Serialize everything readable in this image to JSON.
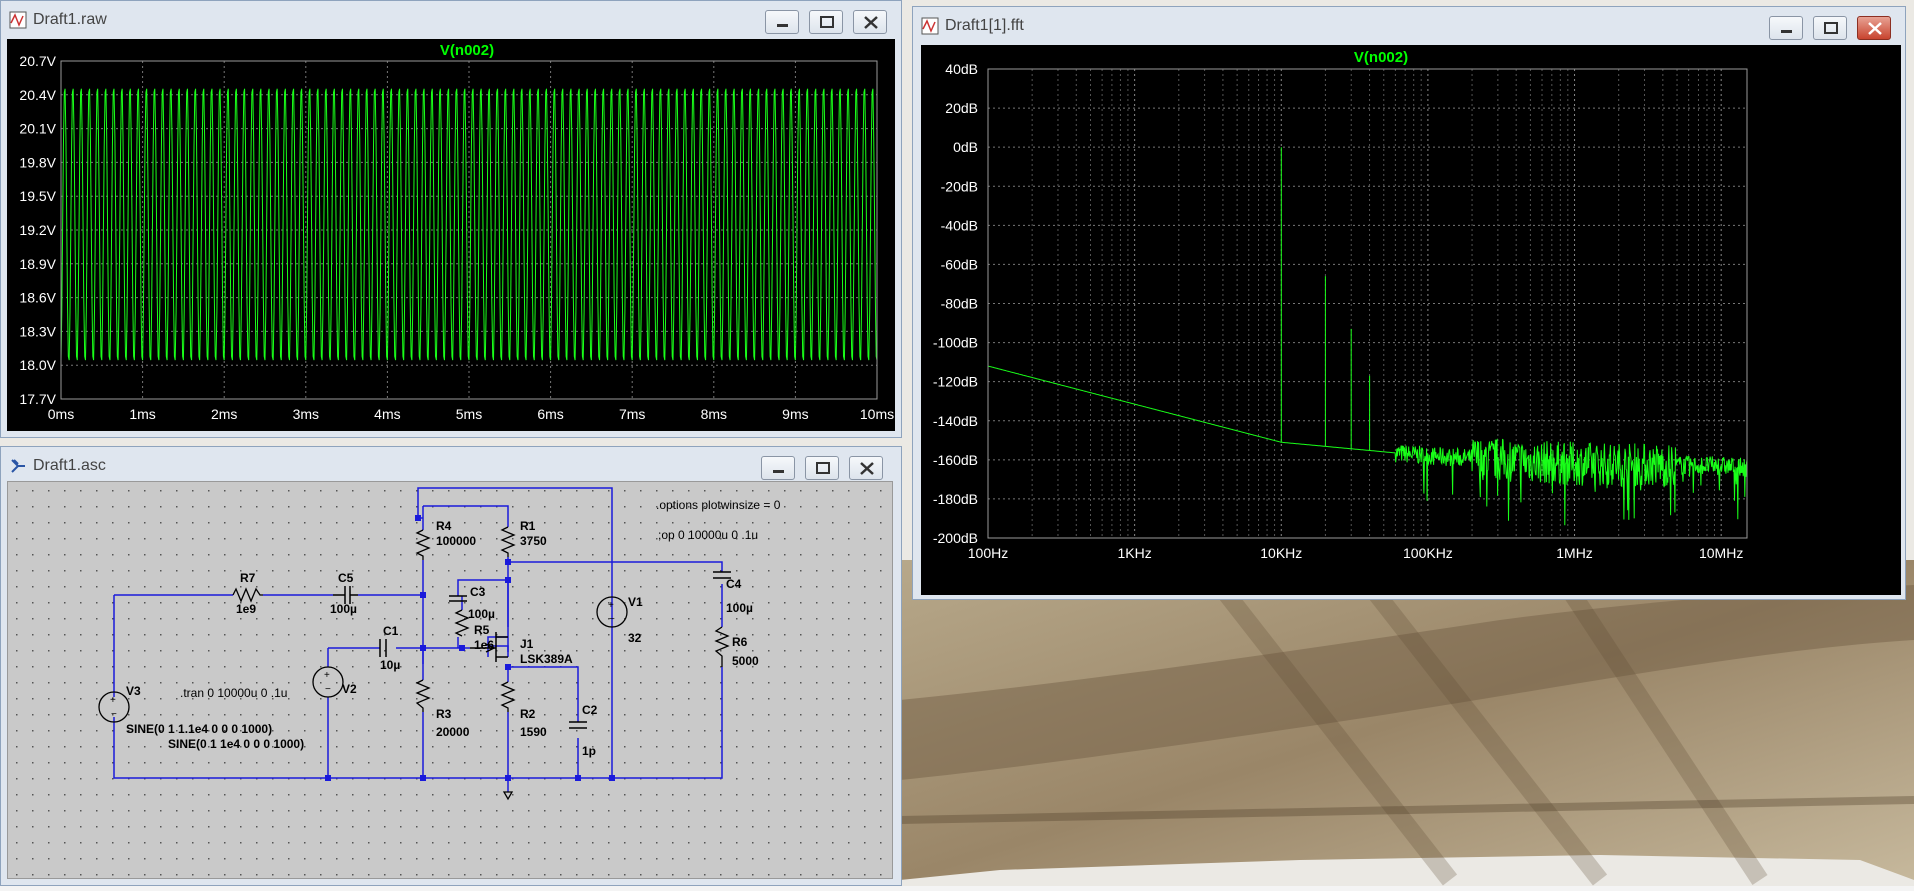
{
  "windows": {
    "raw": {
      "title": "Draft1.raw",
      "trace": "V(n002)",
      "y_ticks": [
        "20.7V",
        "20.4V",
        "20.1V",
        "19.8V",
        "19.5V",
        "19.2V",
        "18.9V",
        "18.6V",
        "18.3V",
        "18.0V",
        "17.7V"
      ],
      "x_ticks": [
        "0ms",
        "1ms",
        "2ms",
        "3ms",
        "4ms",
        "5ms",
        "6ms",
        "7ms",
        "8ms",
        "9ms",
        "10ms"
      ]
    },
    "fft": {
      "title": "Draft1[1].fft",
      "trace": "V(n002)",
      "y_ticks": [
        "40dB",
        "20dB",
        "0dB",
        "-20dB",
        "-40dB",
        "-60dB",
        "-80dB",
        "-100dB",
        "-120dB",
        "-140dB",
        "-160dB",
        "-180dB",
        "-200dB"
      ],
      "x_ticks": [
        "100Hz",
        "1KHz",
        "10KHz",
        "100KHz",
        "1MHz",
        "10MHz"
      ]
    },
    "schematic": {
      "title": "Draft1.asc",
      "labels": {
        "r7": "R7",
        "r7v": "1e9",
        "c5": "C5",
        "c5v": "100µ",
        "r4": "R4",
        "r4v": "100000",
        "r1": "R1",
        "r1v": "3750",
        "c3": "C3",
        "c3v": "100µ",
        "r5": "R5",
        "r5v": "1e6",
        "j1": "J1",
        "j1v": "LSK389A",
        "v1": "V1",
        "v1v": "32",
        "c4": "C4",
        "c4v": "100µ",
        "r6": "R6",
        "r6v": "5000",
        "c1": "C1",
        "c1v": "10µ",
        "v3": "V3",
        "v3v": "SINE(0 1 1.1e4 0 0 0 1000)",
        "v2": "V2",
        "v2v": "SINE(0 1 1e4 0 0 0 1000)",
        "r3": "R3",
        "r3v": "20000",
        "r2": "R2",
        "r2v": "1590",
        "c2": "C2",
        "c2v": "1p"
      },
      "directives": {
        "options": ".options plotwinsize = 0",
        "op": ";op 0 10000u 0 .1u",
        "tran": ".tran 0 10000u 0 .1u"
      }
    }
  },
  "chart_data": [
    {
      "type": "line",
      "title": "V(n002)",
      "xlabel": "",
      "ylabel": "",
      "xlim": [
        0,
        10
      ],
      "x_unit": "ms",
      "ylim": [
        17.7,
        20.7
      ],
      "y_unit": "V",
      "grid": true,
      "series": [
        {
          "name": "V(n002)",
          "waveform": "sine",
          "frequency_hz": 10000,
          "min": 18.0,
          "max": 20.5
        }
      ]
    },
    {
      "type": "line",
      "title": "V(n002)",
      "xlabel": "",
      "ylabel": "",
      "x_scale": "log",
      "xlim": [
        100,
        15000000
      ],
      "x_unit": "Hz",
      "ylim": [
        -200,
        40
      ],
      "y_unit": "dB",
      "grid": true,
      "series": [
        {
          "name": "V(n002)",
          "points": [
            [
              100,
              -112
            ],
            [
              1000,
              -125
            ],
            [
              10000,
              -151
            ],
            [
              10000,
              0
            ],
            [
              20000,
              -66
            ],
            [
              30000,
              -93
            ],
            [
              40000,
              -117
            ],
            [
              100000,
              -158
            ],
            [
              1000000,
              -162
            ],
            [
              10000000,
              -163
            ],
            [
              15000000,
              -164
            ]
          ]
        }
      ]
    }
  ]
}
